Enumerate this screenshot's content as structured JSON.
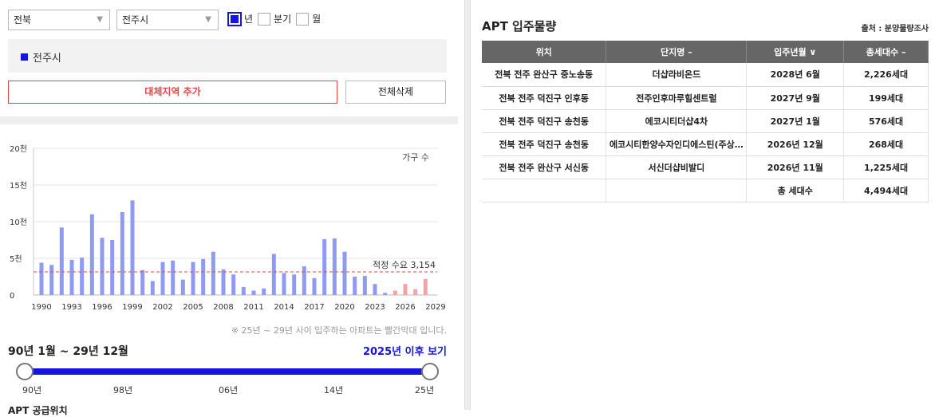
{
  "filters": {
    "region": "전북",
    "city": "전주시",
    "periods": [
      {
        "label": "년",
        "checked": true
      },
      {
        "label": "분기",
        "checked": false
      },
      {
        "label": "월",
        "checked": false
      }
    ]
  },
  "selected_regions": [
    "전주시"
  ],
  "buttons": {
    "add": "대체지역 추가",
    "delete_all": "전체삭제"
  },
  "chart_data": {
    "type": "bar",
    "legend_label": "가구 수",
    "ylabels": [
      "20천",
      "15천",
      "10천",
      "5천",
      "0"
    ],
    "xlabels": [
      "1990",
      "1993",
      "1996",
      "1999",
      "2002",
      "2005",
      "2008",
      "2011",
      "2014",
      "2017",
      "2020",
      "2023",
      "2026",
      "2029"
    ],
    "ylim": [
      0,
      20000
    ],
    "categories": [
      1990,
      1991,
      1992,
      1993,
      1994,
      1995,
      1996,
      1997,
      1998,
      1999,
      2000,
      2001,
      2002,
      2003,
      2004,
      2005,
      2006,
      2007,
      2008,
      2009,
      2010,
      2011,
      2012,
      2013,
      2014,
      2015,
      2016,
      2017,
      2018,
      2019,
      2020,
      2021,
      2022,
      2023,
      2024,
      2025,
      2026,
      2027,
      2028
    ],
    "values": [
      4400,
      4100,
      9200,
      4800,
      5100,
      11000,
      7800,
      7500,
      11300,
      12900,
      3400,
      1900,
      4500,
      4700,
      2100,
      4500,
      4900,
      5900,
      3500,
      2800,
      1100,
      600,
      900,
      5600,
      3000,
      2800,
      3900,
      2300,
      7600,
      7700,
      5900,
      2500,
      2600,
      1500,
      300,
      600,
      1500,
      800,
      2200
    ],
    "future_from": 2025,
    "colors": {
      "past": "#8f9bf1",
      "future": "#f5a3a3",
      "ref": "#e04848"
    },
    "reference": {
      "value": 3154,
      "label": "적정 수요 3,154"
    }
  },
  "note": "※ 25년 ~ 29년 사이 입주하는 아파트는 빨간막대 입니다.",
  "period": {
    "label": "90년 1월 ~ 29년 12월",
    "after_link": "2025년 이후 보기"
  },
  "slider": {
    "labels": [
      "90년",
      "98년",
      "06년",
      "14년",
      "25년"
    ]
  },
  "next_section": "APT 공급위치",
  "right": {
    "title": "APT 입주물량",
    "source": "출처 : 분양물량조사",
    "headers": [
      "위치",
      "단지명 –",
      "입주년월 ∨",
      "총세대수 –"
    ],
    "rows": [
      [
        "전북 전주 완산구 중노송동",
        "더샵라비온드",
        "2028년 6월",
        "2,226세대"
      ],
      [
        "전북 전주 덕진구 인후동",
        "전주인후마루힐센트럴",
        "2027년 9월",
        "199세대"
      ],
      [
        "전북 전주 덕진구 송천동",
        "에코시티더샵4차",
        "2027년 1월",
        "576세대"
      ],
      [
        "전북 전주 덕진구 송천동",
        "에코시티한양수자인디에스틴(주상…",
        "2026년 12월",
        "268세대"
      ],
      [
        "전북 전주 완산구 서신동",
        "서신더샵비발디",
        "2026년 11월",
        "1,225세대"
      ]
    ],
    "total": {
      "label": "총 세대수",
      "value": "4,494세대"
    }
  }
}
